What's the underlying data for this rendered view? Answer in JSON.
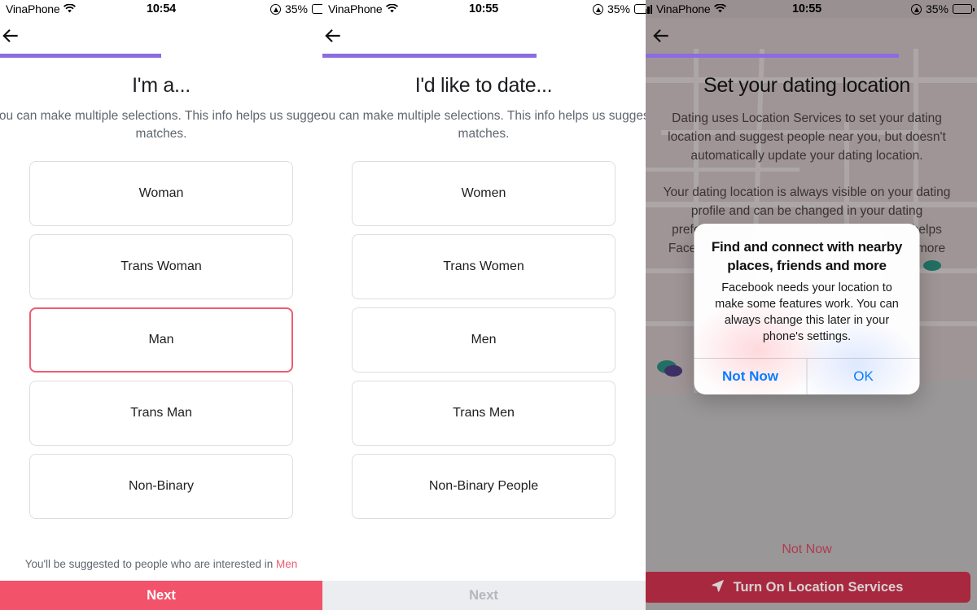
{
  "screens": [
    {
      "status": {
        "carrier": "VinaPhone",
        "time": "10:54",
        "battery_pct": "35%",
        "location_icon": "location-arrow-icon",
        "wifi_icon": "wifi-icon",
        "signal_icon": "cellular-signal-icon",
        "battery_icon": "battery-icon"
      },
      "back_icon": "back-arrow-icon",
      "progress_pct": 50,
      "title": "I'm a...",
      "subtitle_line1": "You can make multiple selections. This info helps us suggest",
      "subtitle_line2": "matches.",
      "options": [
        {
          "label": "Woman",
          "selected": false
        },
        {
          "label": "Trans Woman",
          "selected": false
        },
        {
          "label": "Man",
          "selected": true
        },
        {
          "label": "Trans Man",
          "selected": false
        },
        {
          "label": "Non-Binary",
          "selected": false
        }
      ],
      "footnote_prefix": "You'll be suggested to people who are interested in ",
      "footnote_highlight": "Men",
      "cta_label": "Next",
      "cta_enabled": true
    },
    {
      "status": {
        "carrier": "VinaPhone",
        "time": "10:55",
        "battery_pct": "35%",
        "location_icon": "location-arrow-icon",
        "wifi_icon": "wifi-icon",
        "signal_icon": "cellular-signal-icon",
        "battery_icon": "battery-icon"
      },
      "back_icon": "back-arrow-icon",
      "progress_pct": 65,
      "title": "I'd like to date...",
      "subtitle_line1": "You can make multiple selections. This info helps us suggest",
      "subtitle_line2": "matches.",
      "options": [
        {
          "label": "Women",
          "selected": false
        },
        {
          "label": "Trans Women",
          "selected": false
        },
        {
          "label": "Men",
          "selected": false
        },
        {
          "label": "Trans Men",
          "selected": false
        },
        {
          "label": "Non-Binary People",
          "selected": false
        }
      ],
      "cta_label": "Next",
      "cta_enabled": false
    },
    {
      "status": {
        "carrier": "VinaPhone",
        "time": "10:55",
        "battery_pct": "35%",
        "location_icon": "location-arrow-icon",
        "wifi_icon": "wifi-icon",
        "signal_icon": "cellular-signal-icon",
        "battery_icon": "battery-icon"
      },
      "back_icon": "back-arrow-icon",
      "progress_pct": 77,
      "title": "Set your dating location",
      "body_p1": "Dating uses Location Services to set your dating location and suggest people near you, but doesn't automatically update your dating location.",
      "body_p2": "Your dating location is always visible on your dating profile and can be changed in your dating preferences. Turning on Location Services helps Facebook confirm your location and provide more relevant experiences.",
      "not_now_label": "Not Now",
      "cta_label": "Turn On Location Services",
      "cta_icon": "navigation-arrow-icon",
      "alert": {
        "title": "Find and connect with nearby places, friends and more",
        "message": "Facebook needs your location to make some features work. You can always change this later in your phone's settings.",
        "buttons": [
          {
            "label": "Not Now",
            "bold": true
          },
          {
            "label": "OK",
            "bold": false
          }
        ]
      }
    }
  ],
  "colors": {
    "progress": "#8C6CE0",
    "cta_primary": "#F2536B",
    "cta_disabled_bg": "#ebedf0",
    "selected_border": "#EE5C6F",
    "alert_action": "#0a7cff",
    "cta_location": "#A8293F",
    "not_now_link": "#AE3B4E"
  }
}
